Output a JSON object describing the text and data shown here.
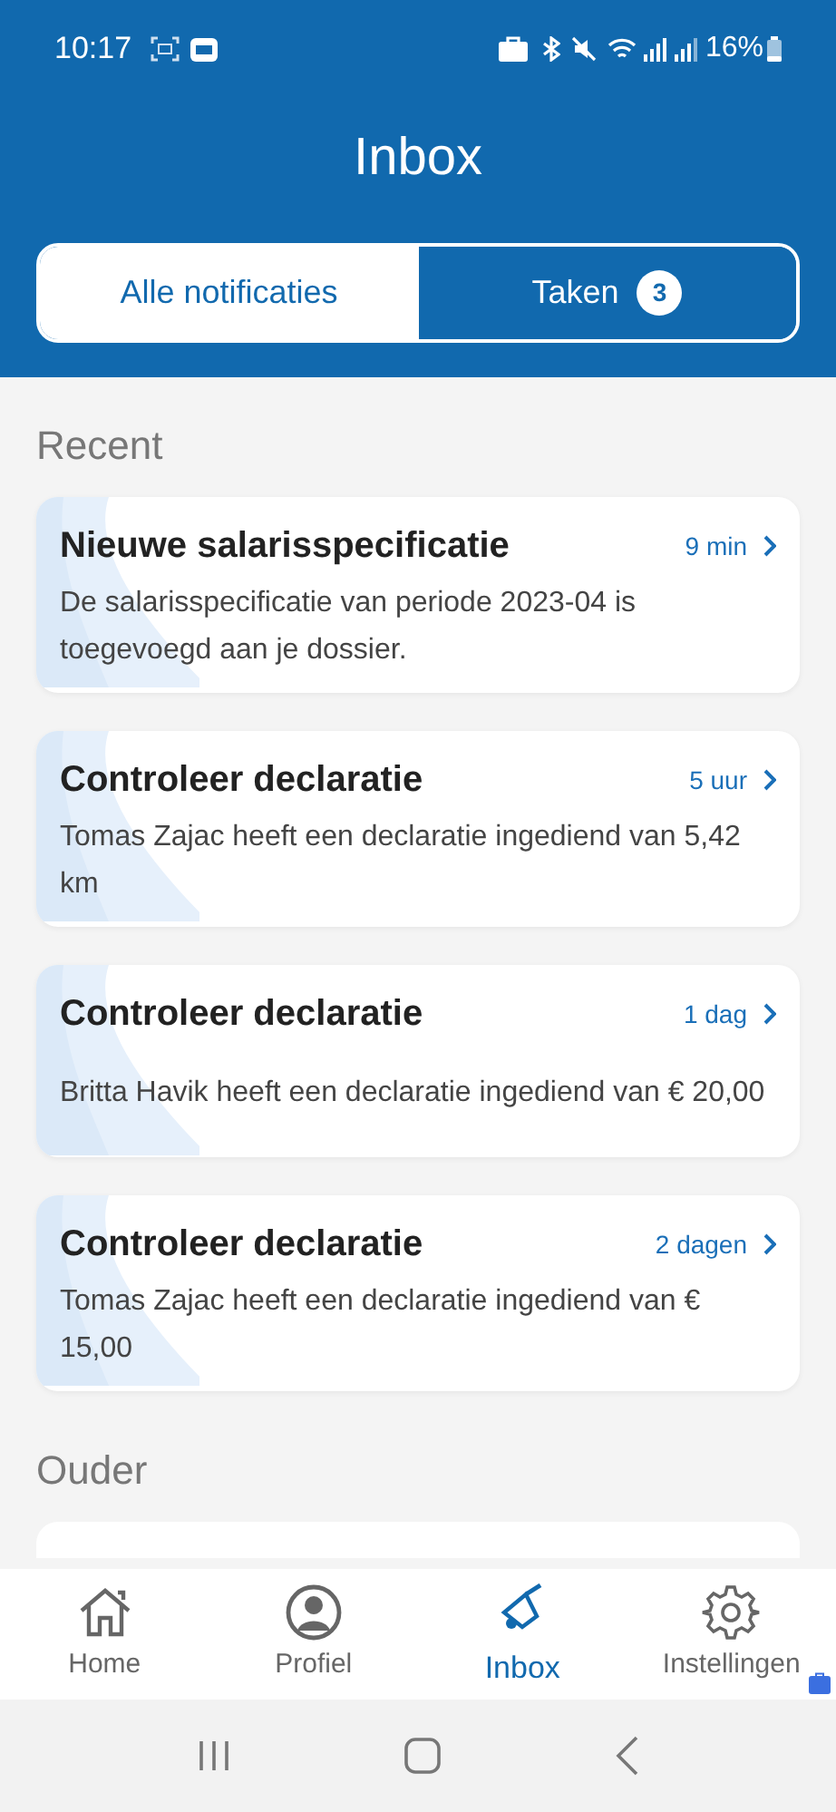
{
  "status_bar": {
    "time": "10:17",
    "battery": "16%"
  },
  "header": {
    "title": "Inbox"
  },
  "tabs": [
    {
      "label": "Alle notificaties",
      "selected": true
    },
    {
      "label": "Taken",
      "badge": "3",
      "selected": false
    }
  ],
  "sections": [
    {
      "title": "Recent",
      "items": [
        {
          "title": "Nieuwe salarisspecificatie",
          "time": "9 min",
          "body": "De salarisspecificatie van periode 2023-04 is toegevoegd aan je dossier."
        },
        {
          "title": "Controleer declaratie",
          "time": "5 uur",
          "body": "Tomas Zajac heeft een declaratie ingediend van 5,42 km"
        },
        {
          "title": "Controleer declaratie",
          "time": "1 dag",
          "body": "Britta Havik heeft een declaratie ingediend van € 20,00"
        },
        {
          "title": "Controleer declaratie",
          "time": "2 dagen",
          "body": "Tomas Zajac heeft een declaratie ingediend van € 15,00"
        }
      ]
    },
    {
      "title": "Ouder"
    }
  ],
  "bottom_nav": [
    {
      "label": "Home",
      "kind": "home",
      "selected": false
    },
    {
      "label": "Profiel",
      "kind": "profile",
      "selected": false
    },
    {
      "label": "Inbox",
      "kind": "bell",
      "selected": true
    },
    {
      "label": "Instellingen",
      "kind": "gear",
      "selected": false
    }
  ]
}
